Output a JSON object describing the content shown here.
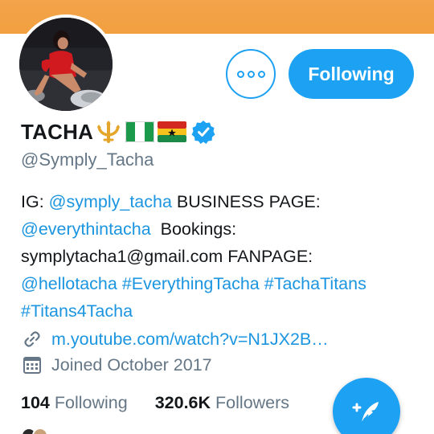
{
  "profile": {
    "display_name": "TACHA",
    "name_emojis": [
      "trident-emoji",
      "nigeria-flag-emoji",
      "ghana-flag-emoji"
    ],
    "verified": true,
    "handle": "@Symply_Tacha",
    "bio": {
      "line1_a": "IG: ",
      "line1_link": "@symply_tacha",
      "line1_b": " BUSINESS PAGE:",
      "line2_link": "@everythintacha",
      "line2_b": "  Bookings:",
      "line3": "symplytacha1@gmail.com FANPAGE:",
      "line4_link1": "@hellotacha",
      "line4_link2": "#EverythingTacha",
      "line4_link3": "#TachaTitans",
      "line5_link": "#Titans4Tacha"
    },
    "website": "m.youtube.com/watch?v=N1JX2B…",
    "joined": "Joined October 2017"
  },
  "buttons": {
    "following_label": "Following"
  },
  "stats": {
    "following_count": "104",
    "following_label": "Following",
    "followers_count": "320.6K",
    "followers_label": "Followers"
  },
  "icons": {
    "more": "more-options-icon",
    "verified": "verified-badge-icon",
    "link": "link-icon",
    "calendar": "calendar-icon",
    "compose": "compose-tweet-icon"
  },
  "colors": {
    "accent": "#1da1f2",
    "link": "#1b95e0",
    "banner": "#f2a040",
    "secondary_text": "#657786"
  }
}
